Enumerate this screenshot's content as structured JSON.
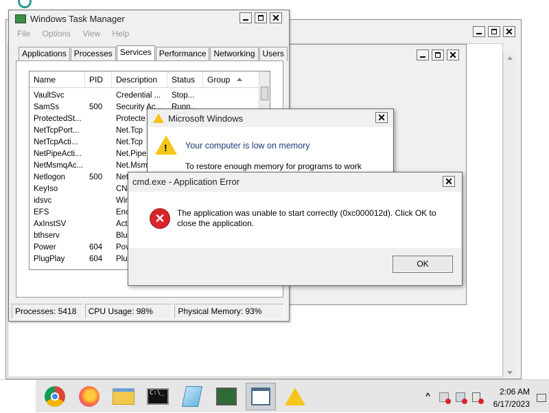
{
  "task_manager": {
    "title": "Windows Task Manager",
    "menu": [
      "File",
      "Options",
      "View",
      "Help"
    ],
    "tabs": [
      "Applications",
      "Processes",
      "Services",
      "Performance",
      "Networking",
      "Users"
    ],
    "active_tab": "Services",
    "columns": [
      "Name",
      "PID",
      "Description",
      "Status",
      "Group"
    ],
    "rows": [
      {
        "name": "VaultSvc",
        "pid": "",
        "desc": "Credential ...",
        "status": "Stop..."
      },
      {
        "name": "SamSs",
        "pid": "500",
        "desc": "Security Ac...",
        "status": "Runn..."
      },
      {
        "name": "ProtectedSt...",
        "pid": "",
        "desc": "Protecte",
        "status": ""
      },
      {
        "name": "NetTcpPort...",
        "pid": "",
        "desc": "Net.Tcp",
        "status": ""
      },
      {
        "name": "NetTcpActi...",
        "pid": "",
        "desc": "Net.Tcp",
        "status": ""
      },
      {
        "name": "NetPipeActi...",
        "pid": "",
        "desc": "Net.Pipe",
        "status": ""
      },
      {
        "name": "NetMsmqAc...",
        "pid": "",
        "desc": "Net.Msm",
        "status": ""
      },
      {
        "name": "Netlogon",
        "pid": "500",
        "desc": "Net",
        "status": ""
      },
      {
        "name": "KeyIso",
        "pid": "",
        "desc": "CNC",
        "status": ""
      },
      {
        "name": "idsvc",
        "pid": "",
        "desc": "Win",
        "status": ""
      },
      {
        "name": "EFS",
        "pid": "",
        "desc": "Enc",
        "status": ""
      },
      {
        "name": "AxInstSV",
        "pid": "",
        "desc": "Acti",
        "status": ""
      },
      {
        "name": "bthserv",
        "pid": "",
        "desc": "Blue",
        "status": ""
      },
      {
        "name": "Power",
        "pid": "604",
        "desc": "Pov",
        "status": ""
      },
      {
        "name": "PlugPlay",
        "pid": "604",
        "desc": "Plug",
        "status": ""
      }
    ],
    "status": {
      "processes": "Processes: 5418",
      "cpu": "CPU Usage: 98%",
      "memory": "Physical Memory: 93%"
    }
  },
  "low_memory_dialog": {
    "title": "Microsoft Windows",
    "message": "Your computer is low on memory",
    "detail": "To restore enough memory for programs to work"
  },
  "error_dialog": {
    "title": "cmd.exe - Application Error",
    "message": "The application was unable to start correctly (0xc000012d). Click OK to close the application.",
    "ok_label": "OK"
  },
  "taskbar": {
    "apps": [
      "chrome-icon",
      "firefox-icon",
      "file-explorer-icon",
      "cmd-icon",
      "notepad-icon",
      "task-manager-icon",
      "window-icon",
      "warning-icon"
    ],
    "tray_chevron": "^",
    "time": "2:06 AM",
    "date": "6/17/2023"
  },
  "colors": {
    "error_red": "#d7262b",
    "warning_yellow": "#f5c518",
    "taskbar_bg": "#e6e6e6"
  }
}
